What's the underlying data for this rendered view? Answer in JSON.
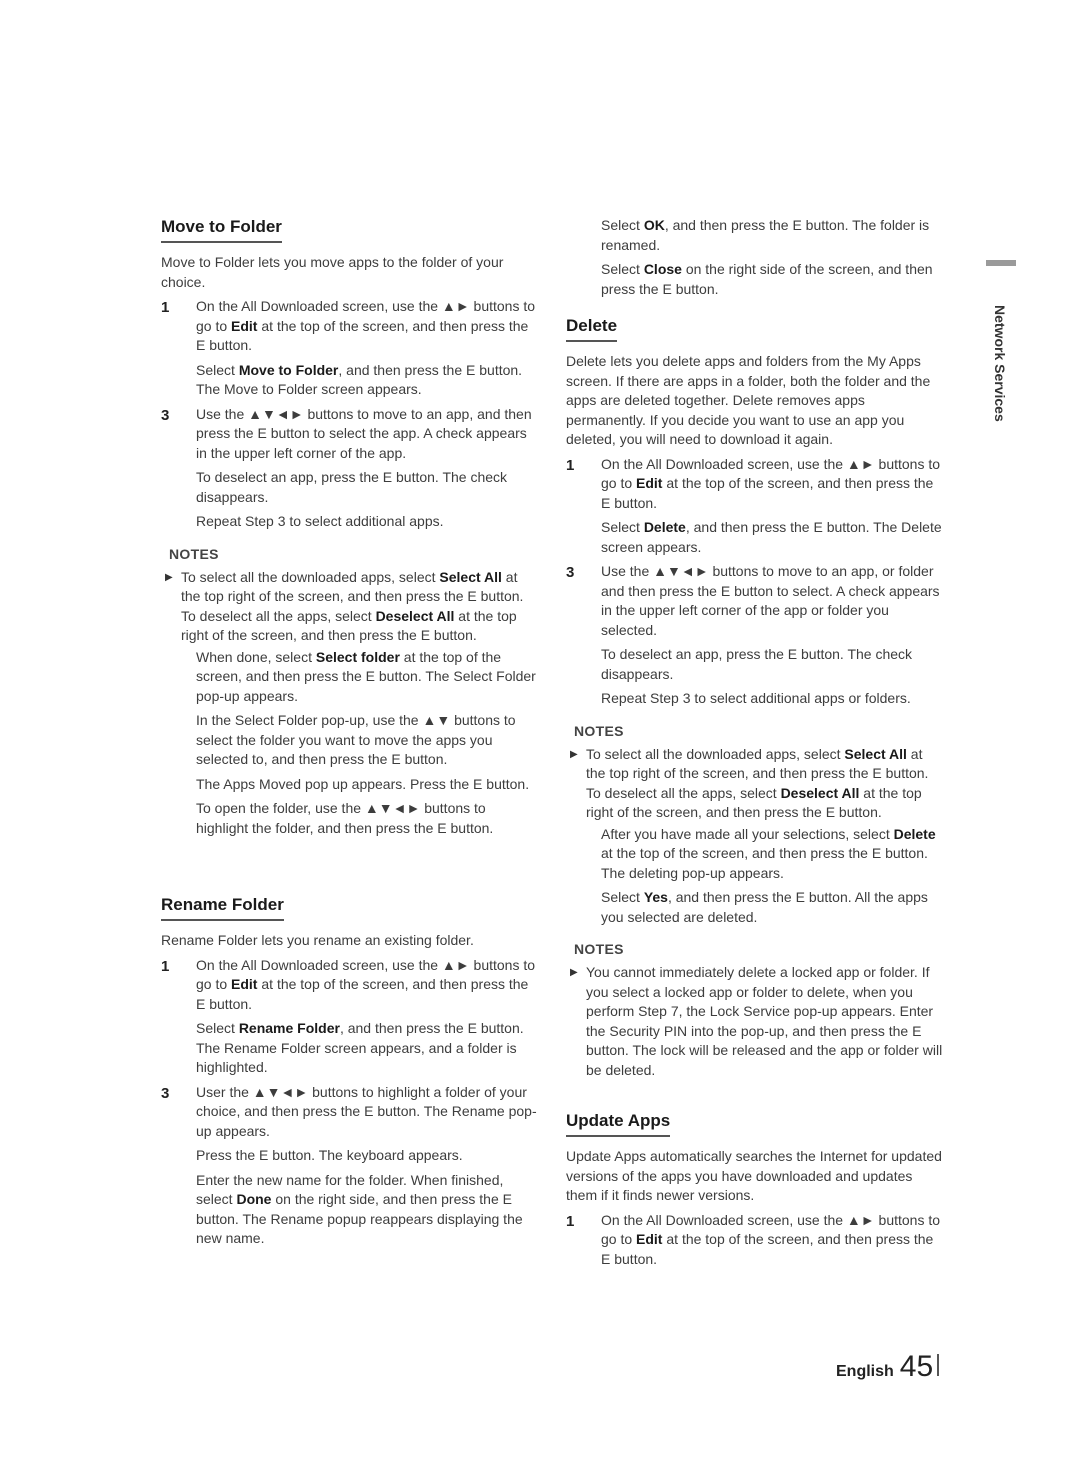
{
  "side_tab": {
    "label": "Network Services"
  },
  "footer": {
    "language": "English",
    "page_number": "45"
  },
  "left": {
    "move_to_folder": {
      "title": "Move to Folder",
      "intro": "Move to Folder lets you move apps to the folder of your choice.",
      "step1": {
        "num": "1",
        "text_a": "On the All Downloaded screen, use the ▲► buttons to go to ",
        "bold": "Edit",
        "text_b": " at the top of the screen, and then press the E button."
      },
      "step2": {
        "text_a": "Select ",
        "bold": "Move to Folder",
        "text_b": ", and then press the E button. The Move to Folder screen appears."
      },
      "step3": {
        "num": "3",
        "text": "Use the ▲▼◄► buttons to move to an app, and then press the E button to select the app. A check appears in the upper left corner of the app."
      },
      "step4": "To deselect an app, press the E button. The check disappears.",
      "step5": "Repeat Step 3 to select additional apps.",
      "notes_title": "NOTES",
      "note1": {
        "a": "To select all the downloaded apps, select ",
        "b1": "Select All",
        "c": " at the top right of the screen, and then press the E button. To deselect all the apps, select ",
        "b2": "Deselect All",
        "d": " at the top right of the screen, and then press the E button."
      },
      "note_sub1": {
        "a": "When done, select ",
        "b": "Select folder",
        "c": " at the top of the screen, and then press the E button. The Select Folder pop-up appears."
      },
      "note_sub2": "In the Select Folder pop-up, use the ▲▼ buttons to select the folder you want to move the apps you selected to, and then press the E button.",
      "note_sub3": "The Apps Moved pop up appears. Press the E button.",
      "note_sub4": "To open the folder, use the ▲▼◄► buttons to highlight the folder, and then press the E button."
    },
    "rename_folder": {
      "title": "Rename Folder",
      "intro": "Rename Folder lets you rename an existing folder.",
      "step1": {
        "num": "1",
        "text_a": "On the All Downloaded screen, use the ▲► buttons to go to ",
        "bold": "Edit",
        "text_b": " at the top of the screen, and then press the E button."
      },
      "step2": {
        "text_a": "Select ",
        "bold": "Rename Folder",
        "text_b": ", and then press the E button. The Rename Folder screen appears, and a folder is highlighted."
      },
      "step3": {
        "num": "3",
        "text": "User the ▲▼◄► buttons to highlight a folder of your choice, and then press the E button. The Rename pop-up appears."
      },
      "step4": "Press the E button. The keyboard appears.",
      "step5": {
        "a": "Enter the new name for the folder. When finished, select ",
        "b": "Done",
        "c": " on the right side, and then press the E button. The Rename popup reappears displaying the new name."
      }
    }
  },
  "right": {
    "rename_cont": {
      "step6": {
        "a": "Select ",
        "b": "OK",
        "c": ", and then press the E button. The folder is renamed."
      },
      "step7": {
        "a": "Select ",
        "b": "Close",
        "c": " on the right side of the screen, and then press the E button."
      }
    },
    "delete": {
      "title": "Delete",
      "intro": "Delete lets you delete apps and folders from the My Apps screen. If there are apps in a folder, both the folder and the apps are deleted together. Delete removes apps permanently. If you decide you want to use an app you deleted, you will need to download it again.",
      "step1": {
        "num": "1",
        "text_a": "On the All Downloaded screen, use the ▲► buttons to go to ",
        "bold": "Edit",
        "text_b": " at the top of the screen, and then press the E button."
      },
      "step2": {
        "a": "Select ",
        "b": "Delete",
        "c": ", and then press the E button. The Delete screen appears."
      },
      "step3": {
        "num": "3",
        "text": "Use the ▲▼◄► buttons to move to an app, or folder and then press the E button to select. A check appears in the upper left corner of the app or folder you selected."
      },
      "step4": "To deselect an app, press the E button. The check disappears.",
      "step5": "Repeat Step 3 to select additional apps or folders.",
      "notes_title": "NOTES",
      "note1": {
        "a": "To select all the downloaded apps, select ",
        "b1": "Select All",
        "c": " at the top right of the screen, and then press the E button. To deselect all the apps, select ",
        "b2": "Deselect All",
        "d": " at the top right of the screen, and then press the E button."
      },
      "note_sub1": {
        "a": "After you have made all your selections, select ",
        "b": "Delete",
        "c": " at the top of the screen, and then press the E button. The deleting pop-up appears."
      },
      "note_sub2": {
        "a": "Select ",
        "b": "Yes",
        "c": ", and then press the E button. All the apps you selected are deleted."
      },
      "notes2_title": "NOTES",
      "note2": "You cannot immediately delete a locked app or folder. If you select a locked app or folder to delete, when you perform Step 7, the Lock Service pop-up appears. Enter the Security PIN into the pop-up, and then press the E button. The lock will be released and the app or folder will be deleted."
    },
    "update_apps": {
      "title": "Update Apps",
      "intro": "Update Apps automatically searches the Internet for updated versions of the apps you have downloaded and updates them if it finds newer versions.",
      "step1": {
        "num": "1",
        "text_a": "On the All Downloaded screen, use the ▲► buttons to go to ",
        "bold": "Edit",
        "text_b": " at the top of the screen, and then press the E button."
      }
    }
  }
}
